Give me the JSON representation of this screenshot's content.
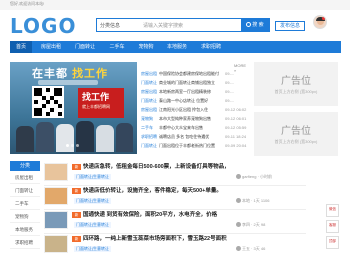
{
  "topbar": {
    "text": "您好,欢迎访问本站!"
  },
  "header": {
    "logo_text": "LOGO",
    "search": {
      "category": "分类信息",
      "placeholder": "请输入关键字搜索",
      "button": "搜 索"
    },
    "post_button": "发布信息"
  },
  "nav": {
    "items": [
      "首页",
      "房屋出租",
      "门面转让",
      "二手车",
      "宠物狗",
      "本地服务",
      "求职招聘"
    ]
  },
  "banner": {
    "title_a": "在丰都",
    "title_b": "找工作",
    "tag_big": "找工作",
    "tag_small": "就上丰都招聘网"
  },
  "list": {
    "more": "MORE »",
    "rows": [
      {
        "cat": "房屋出租",
        "text": "中国保险协会都建房保地出租能付",
        "date": "09-..."
      },
      {
        "cat": "门面转让",
        "text": "商业城的门面转让商铺出租独立",
        "date": "09-..."
      },
      {
        "cat": "房屋出租",
        "text": "本地新房两室一厅出租精装修",
        "date": "09-..."
      },
      {
        "cat": "门面转让",
        "text": "泰山路一中心店转让 位置好",
        "date": "09-..."
      },
      {
        "cat": "房屋出租",
        "text": "江南阳光小区出租 拎包入住",
        "date": "09-12 06:02"
      },
      {
        "cat": "宠物狗",
        "text": "本市大型纯种家养宠物狗出售",
        "date": "09-12 06:01"
      },
      {
        "cat": "二手车",
        "text": "丰都中心大众宝来车出售",
        "date": "09-12 05:59"
      },
      {
        "cat": "求职招聘",
        "text": "诚聘店员 多名 包吃住待遇优",
        "date": "09-11 18:24"
      },
      {
        "cat": "门面转让",
        "text": "门面出租位于丰都老街热门位置",
        "date": "09-09 20:04"
      }
    ]
  },
  "ads": [
    {
      "big": "广告位",
      "small": "首页上方右侧 (宽300px)"
    },
    {
      "big": "广告位",
      "small": "首页上方右侧 (宽300px)"
    }
  ],
  "side": {
    "head": "分类",
    "items": [
      "房屋出租",
      "门面转让",
      "二手车",
      "宠物狗",
      "本地服务",
      "求职招聘"
    ]
  },
  "feed": [
    {
      "tag": "新",
      "title": "快递店急转，低租金每日500-600票，上新设备灯具等物品，",
      "cat": "门面转让|生意转让",
      "meta": "garfieng · 小时前"
    },
    {
      "tag": "新",
      "title": "快递店低价转让，设施齐全，客件稳定，每天500+单量。",
      "cat": "门面转让|生意转让",
      "meta": "本地 · 1天 1106"
    },
    {
      "tag": "新",
      "title": "国通快递 到货有效保险，面积20平方，水电齐全，价格",
      "cat": "门面转让|生意转让",
      "meta": "李四 · 2天 98"
    },
    {
      "tag": "新",
      "title": "四环路，一纯上新雪玉蕊菜市场旁面积下，雪玉路22号面积",
      "cat": "门面转让|生意转让",
      "meta": "王五 · 3天 46"
    }
  ],
  "float_buttons": [
    "微信",
    "客服",
    "顶部"
  ],
  "colors": {
    "primary": "#1e7bd8",
    "logo_accent": "#f0a020",
    "tag_red": "#c81e1e"
  }
}
